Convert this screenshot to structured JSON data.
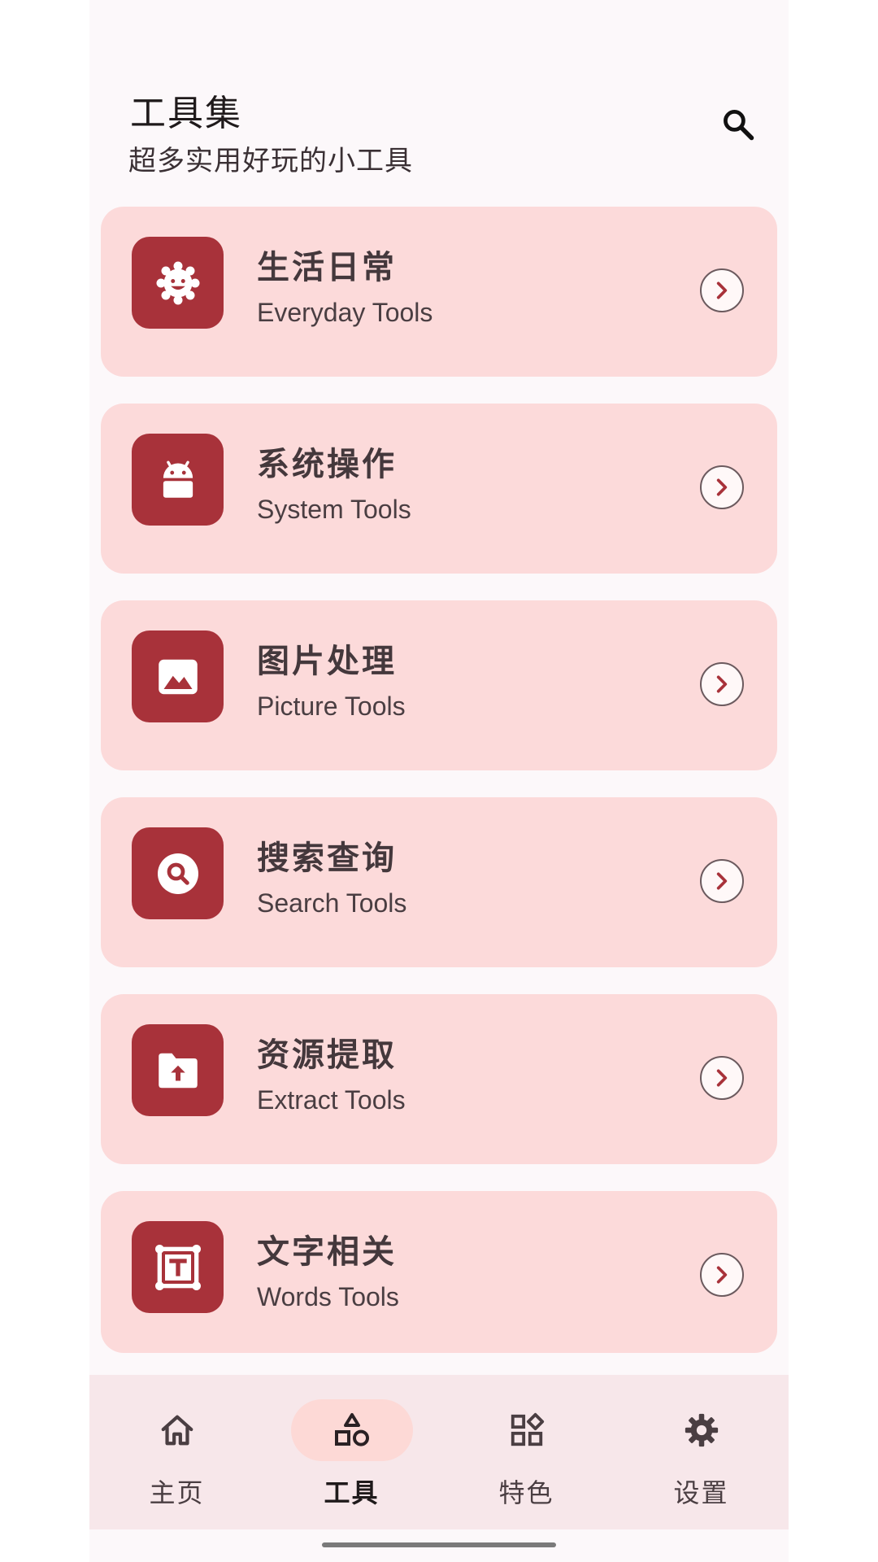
{
  "header": {
    "title": "工具集",
    "subtitle": "超多实用好玩的小工具",
    "search_icon": "search-icon"
  },
  "colors": {
    "background": "#fcf8fa",
    "card_bg": "#fcdada",
    "accent": "#a8323a",
    "nav_bg": "#f7e7ea",
    "nav_active_pill": "#fdd9d6"
  },
  "categories": [
    {
      "title": "生活日常",
      "subtitle": "Everyday Tools",
      "icon": "sun-face-icon"
    },
    {
      "title": "系统操作",
      "subtitle": "System Tools",
      "icon": "android-icon"
    },
    {
      "title": "图片处理",
      "subtitle": "Picture Tools",
      "icon": "image-icon"
    },
    {
      "title": "搜索查询",
      "subtitle": "Search Tools",
      "icon": "search-circle-icon"
    },
    {
      "title": "资源提取",
      "subtitle": "Extract Tools",
      "icon": "folder-upload-icon"
    },
    {
      "title": "文字相关",
      "subtitle": "Words Tools",
      "icon": "text-box-icon"
    }
  ],
  "bottom_nav": {
    "items": [
      {
        "label": "主页",
        "icon": "home-icon"
      },
      {
        "label": "工具",
        "icon": "shapes-icon"
      },
      {
        "label": "特色",
        "icon": "widgets-icon"
      },
      {
        "label": "设置",
        "icon": "gear-icon"
      }
    ],
    "active_index": 1
  }
}
